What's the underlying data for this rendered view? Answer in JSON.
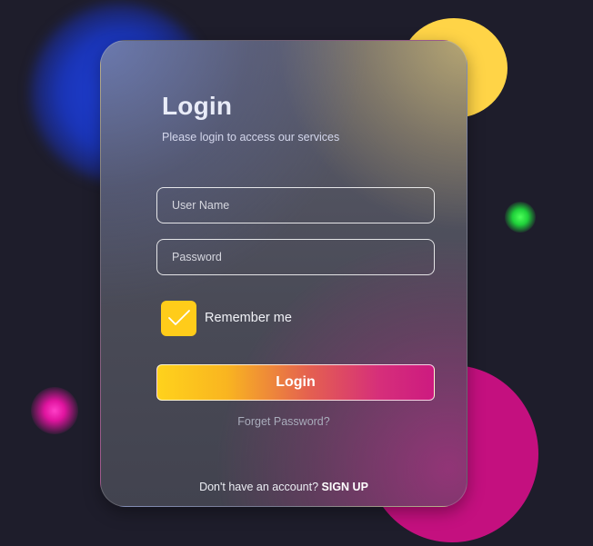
{
  "login_card": {
    "title": "Login",
    "subtitle": "Please login to access our services",
    "username_placeholder": "User Name",
    "password_placeholder": "Password",
    "remember_me_label": "Remember me",
    "remember_me_checked": true,
    "login_button_label": "Login",
    "forgot_password_label": "Forget Password?",
    "signup_prompt": "Don't have an account?",
    "signup_link_label": "SIGN UP"
  },
  "colors": {
    "background": "#1e1d2b",
    "accent_yellow": "#ffd447",
    "accent_magenta": "#c4107f",
    "accent_blue": "#1f3fd6",
    "accent_green": "#1fd13a",
    "checkbox": "#ffcc1a"
  },
  "icons": {
    "checkbox_mark": "checkmark-icon"
  }
}
